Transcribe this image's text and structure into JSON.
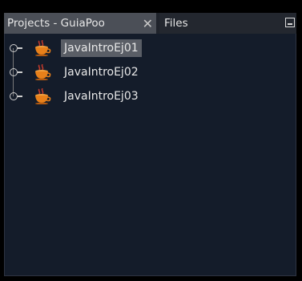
{
  "tabs": {
    "projects_label": "Projects - GuiaPoo",
    "projects_close": "✕",
    "files_label": "Files"
  },
  "tree": {
    "items": [
      {
        "label": "JavaIntroEj01",
        "selected": true
      },
      {
        "label": "JavaIntroEj02",
        "selected": false
      },
      {
        "label": "JavaIntroEj03",
        "selected": false
      }
    ]
  },
  "colors": {
    "panel_bg": "#141c2a",
    "active_tab_bg": "#4b4f57",
    "selection_bg": "#5a5e66",
    "cup_orange": "#e8801a",
    "steam_red": "#c0392b"
  },
  "icons": {
    "project": "java-coffee-cup-icon",
    "expander": "tree-expand-handle-icon",
    "minimize": "minimize-window-icon",
    "close": "close-icon"
  }
}
